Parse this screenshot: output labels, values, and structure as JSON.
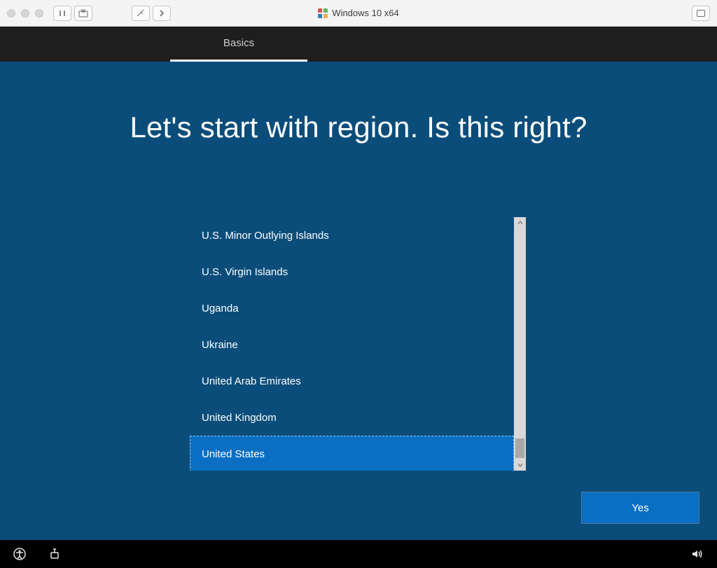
{
  "host": {
    "title": "Windows 10 x64"
  },
  "oobe": {
    "tab_label": "Basics",
    "heading": "Let's start with region. Is this right?",
    "regions": [
      {
        "label": "U.S. Minor Outlying Islands",
        "selected": false
      },
      {
        "label": "U.S. Virgin Islands",
        "selected": false
      },
      {
        "label": "Uganda",
        "selected": false
      },
      {
        "label": "Ukraine",
        "selected": false
      },
      {
        "label": "United Arab Emirates",
        "selected": false
      },
      {
        "label": "United Kingdom",
        "selected": false
      },
      {
        "label": "United States",
        "selected": true
      }
    ],
    "yes_label": "Yes"
  }
}
